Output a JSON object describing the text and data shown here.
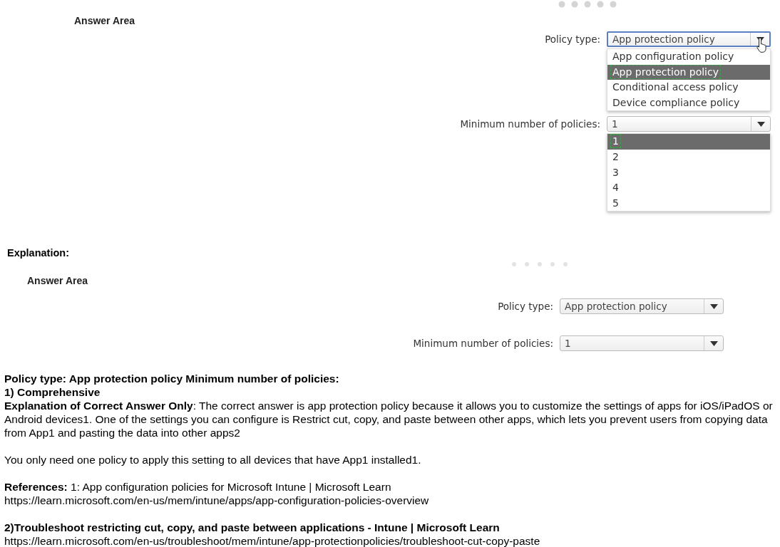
{
  "question_area": {
    "title": "Answer Area",
    "fields": [
      {
        "label": "Policy type:",
        "value": "App protection policy",
        "focused": true,
        "expanded": true,
        "options": [
          {
            "label": "App configuration policy",
            "selected": false,
            "marked": false
          },
          {
            "label": "App protection policy",
            "selected": true,
            "marked": true
          },
          {
            "label": "Conditional access policy",
            "selected": false,
            "marked": false
          },
          {
            "label": "Device compliance policy",
            "selected": false,
            "marked": false
          }
        ]
      },
      {
        "label": "Minimum number of policies:",
        "value": "1",
        "focused": false,
        "expanded": true,
        "options": [
          {
            "label": "1",
            "selected": true,
            "marked": true
          },
          {
            "label": "2",
            "selected": false,
            "marked": false
          },
          {
            "label": "3",
            "selected": false,
            "marked": false
          },
          {
            "label": "4",
            "selected": false,
            "marked": false
          },
          {
            "label": "5",
            "selected": false,
            "marked": false
          }
        ]
      }
    ]
  },
  "explanation_heading": "Explanation:",
  "answer_area": {
    "title": "Answer Area",
    "fields": [
      {
        "label": "Policy type:",
        "value": "App protection policy",
        "focused": false
      },
      {
        "label": "Minimum number of policies:",
        "value": "1",
        "focused": false
      }
    ]
  },
  "paragraphs": [
    [
      {
        "text": "Policy type: App protection policy Minimum number of policies:",
        "bold": true
      },
      {
        "text": "1) Comprehensive",
        "bold": true
      },
      {
        "text": "**Explanation of Correct Answer Only**: The correct answer is app protection policy because it allows you to customize the settings of apps for iOS/iPadOS or Android devices1. One of the settings you can configure is Restrict cut, copy, and paste between other apps, which lets you prevent users from copying data from App1 and pasting the data into other apps2",
        "bold": false
      }
    ],
    [
      {
        "text": "You only need one policy to apply this setting to all devices that have App1 installed1.",
        "bold": false
      }
    ],
    [
      {
        "text": "**References:** 1: App configuration policies for Microsoft Intune | Microsoft Learn",
        "bold": false
      },
      {
        "text": "https://learn.microsoft.com/en-us/mem/intune/apps/app-configuration-policies-overview",
        "bold": false
      }
    ],
    [
      {
        "text": "2)Troubleshoot restricting cut, copy, and paste between applications - Intune | Microsoft Learn",
        "bold": true
      },
      {
        "text": "https://learn.microsoft.com/en-us/troubleshoot/mem/intune/app-protectionpolicies/troubleshoot-cut-copy-paste",
        "bold": false
      }
    ]
  ]
}
